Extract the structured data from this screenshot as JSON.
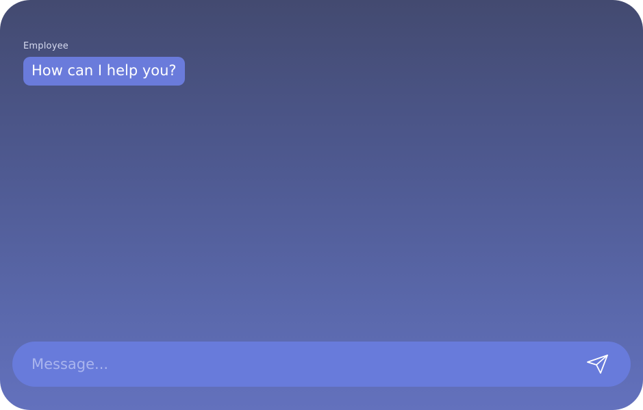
{
  "conversation": {
    "messages": [
      {
        "sender": "Employee",
        "text": "How can I help you?"
      }
    ]
  },
  "composer": {
    "placeholder": "Message...",
    "value": "",
    "send_icon": "paper-plane-icon"
  },
  "colors": {
    "background_top": "#434a70",
    "background_bottom": "#6371bd",
    "bubble": "#6a7bdb",
    "composer": "#687bdb",
    "placeholder": "#aab5ee"
  }
}
